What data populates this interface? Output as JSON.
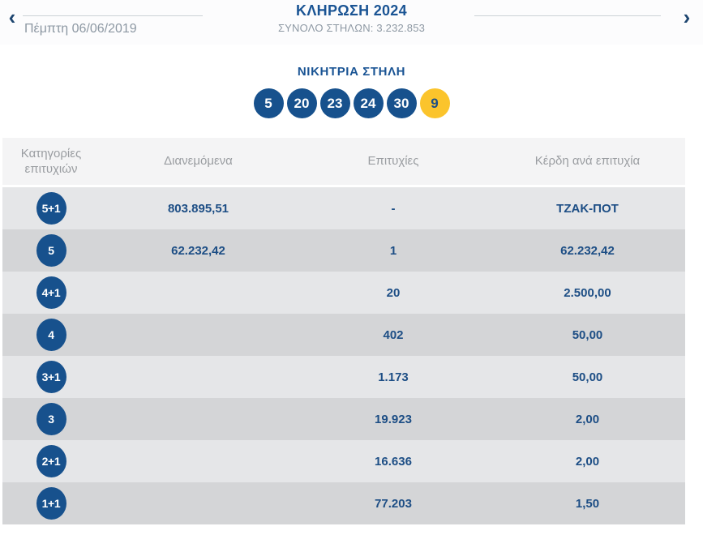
{
  "nav": {
    "prev_icon": "‹",
    "next_icon": "›",
    "title": "ΚΛΗΡΩΣΗ 2024",
    "total_columns": "ΣΥΝΟΛΟ ΣΤΗΛΩΝ: 3.232.853",
    "date": "Πέμπτη 06/06/2019"
  },
  "winning_column": {
    "heading": "ΝΙΚΗΤΡΙΑ ΣΤΗΛΗ",
    "numbers": [
      "5",
      "20",
      "23",
      "24",
      "30"
    ],
    "bonus_number": "9"
  },
  "results_table": {
    "columns": {
      "category": "Κατηγορίες επιτυχιών",
      "distributed": "Διανεμόμενα",
      "wins": "Επιτυχίες",
      "prize": "Κέρδη ανά επιτυχία"
    },
    "rows": [
      {
        "category": "5+1",
        "distributed": "803.895,51",
        "wins": "-",
        "prize": "ΤΖΑΚ-ΠΟΤ"
      },
      {
        "category": "5",
        "distributed": "62.232,42",
        "wins": "1",
        "prize": "62.232,42"
      },
      {
        "category": "4+1",
        "distributed": "",
        "wins": "20",
        "prize": "2.500,00"
      },
      {
        "category": "4",
        "distributed": "",
        "wins": "402",
        "prize": "50,00"
      },
      {
        "category": "3+1",
        "distributed": "",
        "wins": "1.173",
        "prize": "50,00"
      },
      {
        "category": "3",
        "distributed": "",
        "wins": "19.923",
        "prize": "2,00"
      },
      {
        "category": "2+1",
        "distributed": "",
        "wins": "16.636",
        "prize": "2,00"
      },
      {
        "category": "1+1",
        "distributed": "",
        "wins": "77.203",
        "prize": "1,50"
      }
    ]
  },
  "colors": {
    "navy": "#17518d",
    "text_navy": "#1d4e85",
    "yellow": "#fbc42c",
    "gray_text": "#8d98a3",
    "header_text": "#9a9da1",
    "row_light": "#e5e6e8",
    "row_dark": "#d4d5d7",
    "header_bg": "#f4f4f5"
  }
}
